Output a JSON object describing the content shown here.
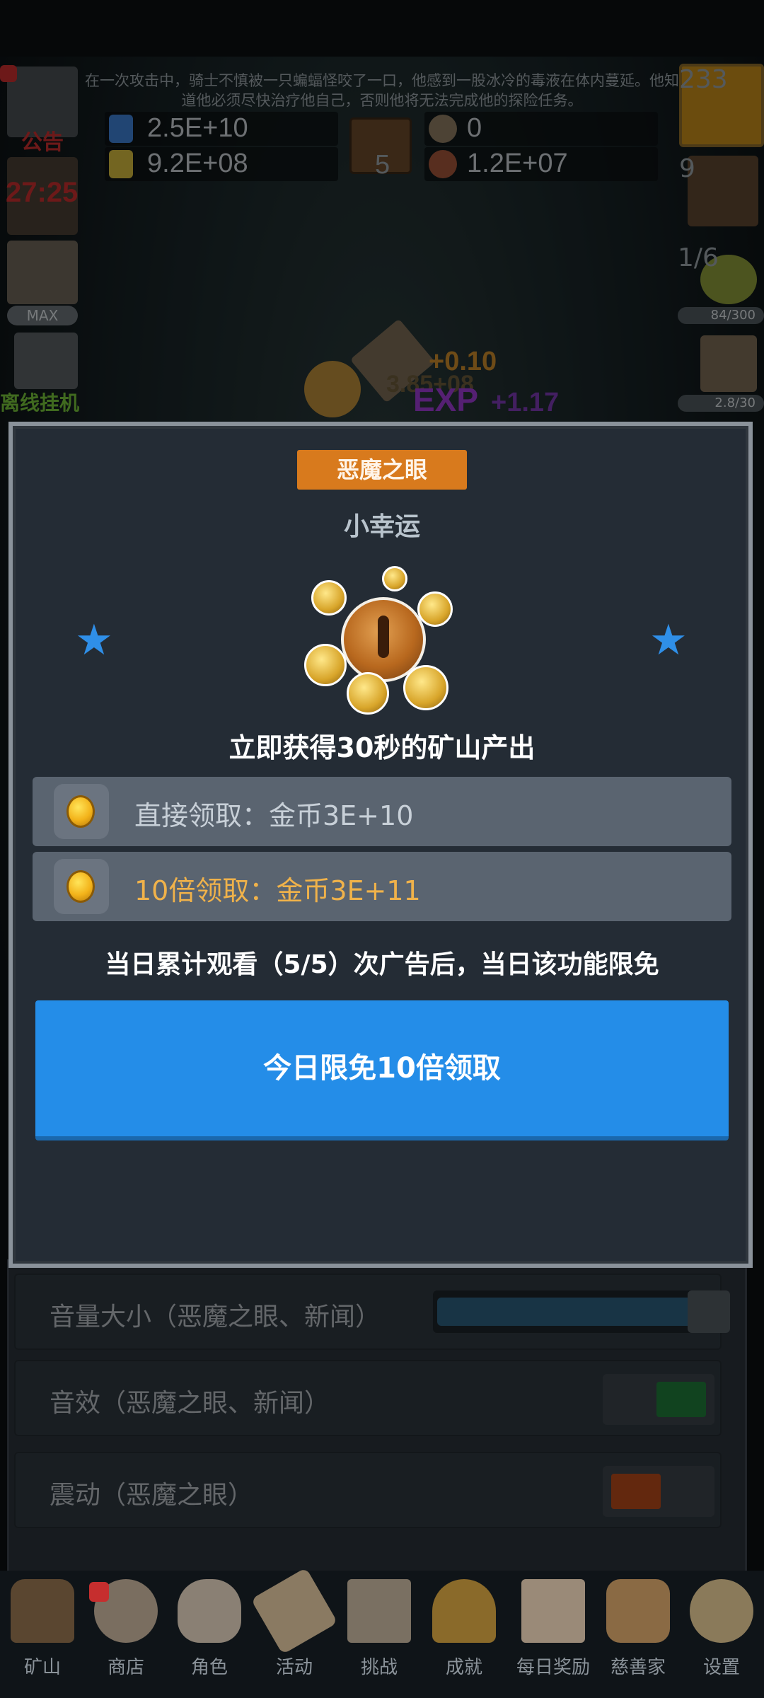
{
  "hud": {
    "story_text": "在一次攻击中，骑士不慎被一只蝙蝠怪咬了一口，他感到一股冰冷的毒液在体内蔓延。他知道他必须尽快治疗他自己，否则他将无法完成他的探险任务。",
    "stat_potion_blue": "2.5E+10",
    "stat_potion_yellow": "9.2E+08",
    "book_count": "5",
    "stat_ore": "0",
    "stat_meat": "1.2E+07",
    "left_notice_label": "公告",
    "timer": "27:25",
    "max_badge": "MAX",
    "offline_label": "离线挂机",
    "right_potion_count": "233",
    "right_chest_count": "9",
    "right_ratio": "1/6",
    "right_bar_1": "84/300",
    "right_bar_2": "2.8/30",
    "floater_gold": "+0.10",
    "floater_exp_label": "EXP",
    "floater_exp": "+1.17",
    "floater_faint": "3.85+08"
  },
  "modal": {
    "title": "恶魔之眼",
    "subtitle": "小幸运",
    "description": "立即获得30秒的矿山产出",
    "reward_direct": "直接领取：金币3E+10",
    "reward_10x": "10倍领取：金币3E+11",
    "notice": "当日累计观看（5/5）次广告后，当日该功能限免",
    "cta_label": "今日限免10倍领取"
  },
  "settings": {
    "volume_label": "音量大小（恶魔之眼、新闻）",
    "volume_level": 0.88,
    "sfx_label": "音效（恶魔之眼、新闻）",
    "sfx_color": "#1f7a3a",
    "vibration_label": "震动（恶魔之眼）",
    "vibration_color": "#b54a1a"
  },
  "nav": {
    "items": [
      {
        "label": "矿山",
        "icon": "lantern-icon"
      },
      {
        "label": "商店",
        "icon": "ore-icon"
      },
      {
        "label": "角色",
        "icon": "skull-icon"
      },
      {
        "label": "活动",
        "icon": "scroll-icon"
      },
      {
        "label": "挑战",
        "icon": "map-icon"
      },
      {
        "label": "成就",
        "icon": "key-icon"
      },
      {
        "label": "每日奖励",
        "icon": "letter-icon"
      },
      {
        "label": "慈善家",
        "icon": "bread-icon"
      },
      {
        "label": "设置",
        "icon": "gear-icon"
      }
    ]
  },
  "colors": {
    "accent_blue": "#248de8",
    "title_orange": "#d87a1d",
    "gold_text": "#f0b24a",
    "alert_red": "#c62e2e"
  }
}
